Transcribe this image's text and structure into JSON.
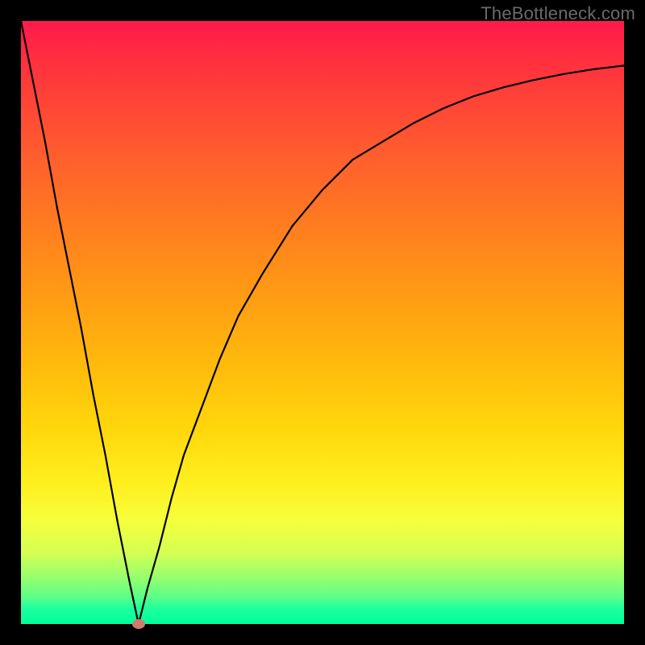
{
  "watermark": "TheBottleneck.com",
  "colors": {
    "frame": "#000000",
    "curve": "#000000",
    "dot": "#d17a6e"
  },
  "chart_data": {
    "type": "line",
    "title": "",
    "xlabel": "",
    "ylabel": "",
    "xlim": [
      0,
      100
    ],
    "ylim": [
      0,
      100
    ],
    "grid": false,
    "legend": false,
    "annotations": [
      {
        "name": "optimal-point",
        "x": 19.5,
        "y": 0
      }
    ],
    "series": [
      {
        "name": "bottleneck-curve",
        "x": [
          0,
          2,
          4,
          6,
          8,
          10,
          12,
          14,
          16,
          18,
          19.5,
          21,
          23,
          25,
          27,
          30,
          33,
          36,
          40,
          45,
          50,
          55,
          60,
          65,
          70,
          75,
          80,
          85,
          90,
          95,
          100
        ],
        "y": [
          100,
          90,
          80,
          69,
          59,
          49,
          38,
          28,
          17,
          7,
          0,
          6,
          13,
          21,
          28,
          36,
          44,
          51,
          58,
          66,
          72,
          77,
          80,
          83,
          85.5,
          87.5,
          89,
          90.2,
          91.2,
          92,
          92.6
        ]
      }
    ]
  }
}
